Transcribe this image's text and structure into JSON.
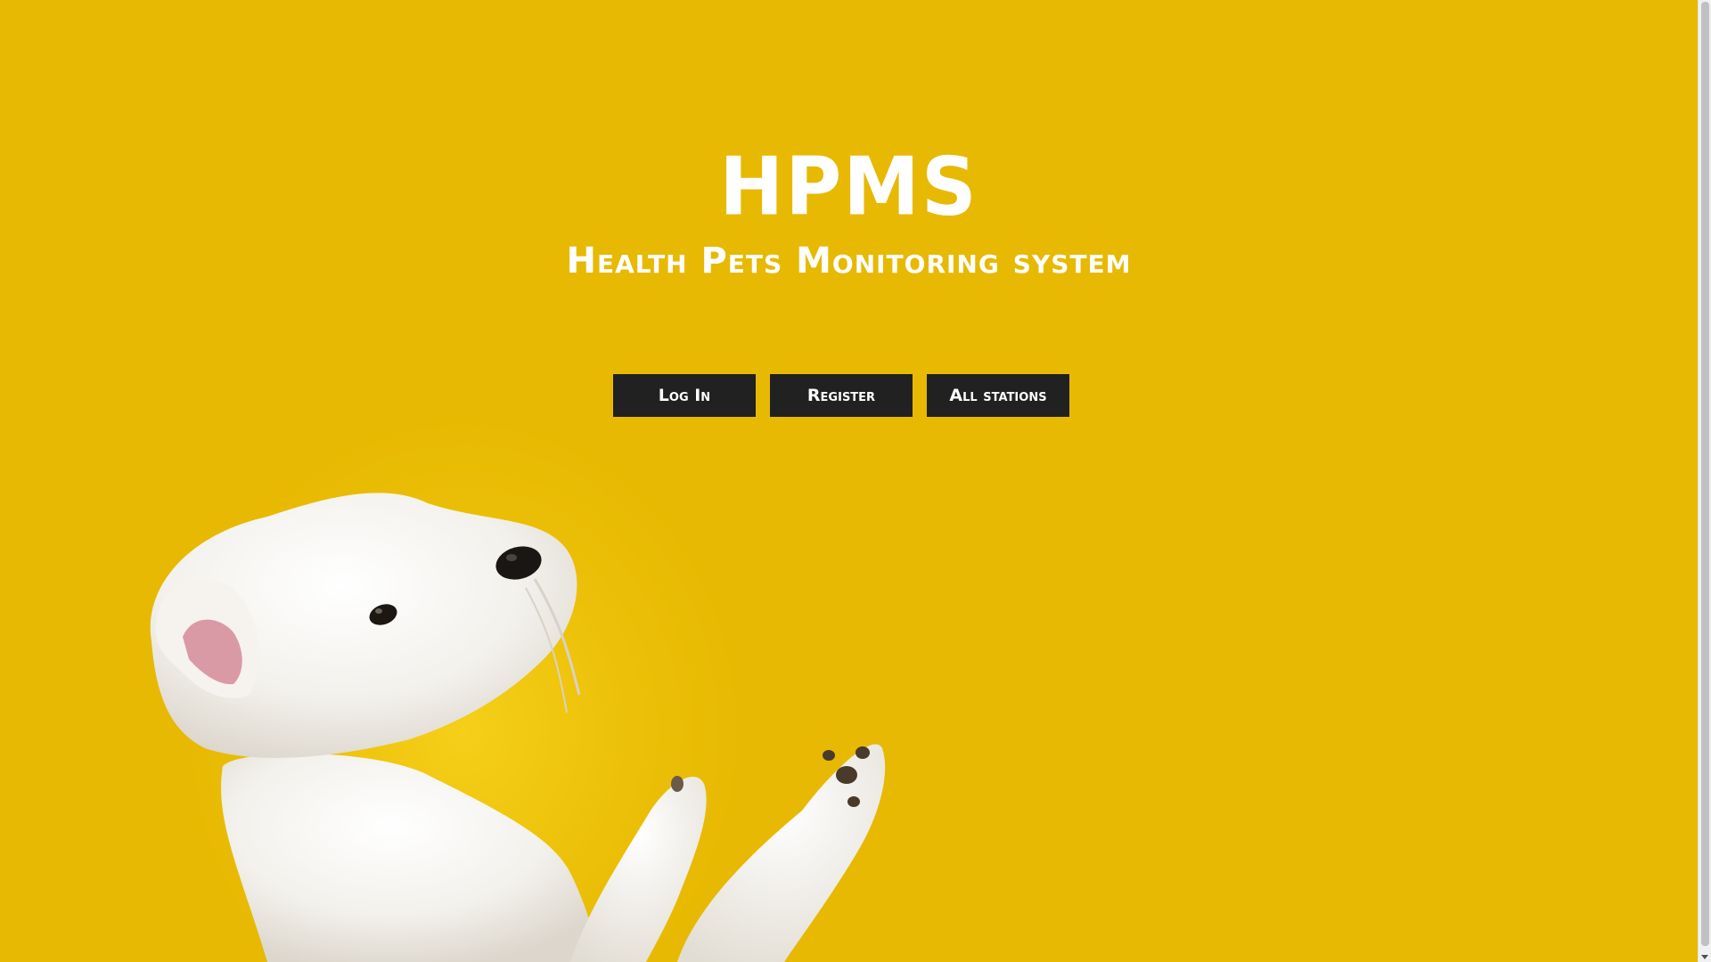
{
  "hero": {
    "title": "HPMS",
    "subtitle": "Health Pets Monitoring system"
  },
  "nav": {
    "buttons": [
      {
        "label": "Log In"
      },
      {
        "label": "Register"
      },
      {
        "label": "All stations"
      }
    ]
  },
  "colors": {
    "background": "#e7b902",
    "button_bg": "#212121",
    "text": "#ffffff"
  },
  "image": {
    "subject": "white-dog-photo"
  }
}
